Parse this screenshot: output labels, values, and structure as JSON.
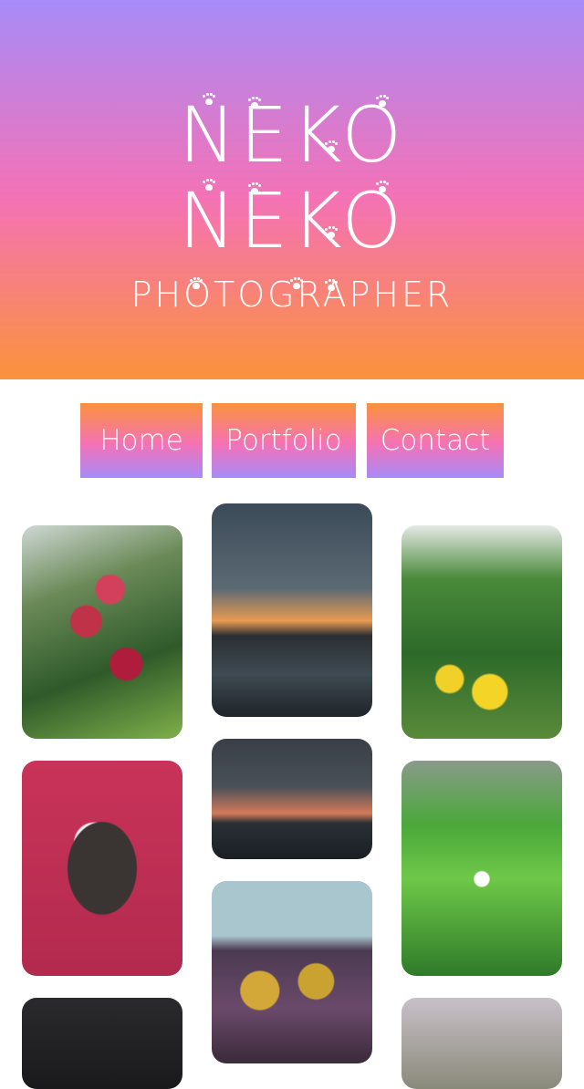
{
  "hero": {
    "title_line1": "NEKO",
    "title_line2": "NEKO",
    "subtitle": "PHOTOGRAPHER"
  },
  "nav": {
    "items": [
      {
        "label": "Home"
      },
      {
        "label": "Portfolio"
      },
      {
        "label": "Contact"
      }
    ]
  },
  "gallery": {
    "photos": [
      {
        "subject": "red flowers with green leaves"
      },
      {
        "subject": "sunset over the sea"
      },
      {
        "subject": "yellow flowers on green bush"
      },
      {
        "subject": "duck in red basin"
      },
      {
        "subject": "dusk harbor with city lights"
      },
      {
        "subject": "green leaves with white flower"
      },
      {
        "subject": "dark photo"
      },
      {
        "subject": "two ducklings on woven mat"
      },
      {
        "subject": "window scene"
      }
    ]
  },
  "colors": {
    "hero_top": "#a78bf8",
    "hero_middle": "#f472b6",
    "hero_bottom": "#fb923c",
    "text": "#ffffff",
    "background": "#ffffff"
  }
}
